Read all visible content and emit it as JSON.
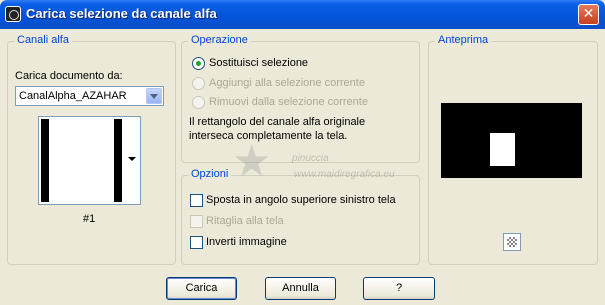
{
  "window": {
    "title": "Carica selezione da canale alfa",
    "close_glyph": "✕"
  },
  "canali_alfa": {
    "legend": "Canali alfa",
    "document_label": "Carica documento da:",
    "document_value": "CanalAlpha_AZAHAR",
    "channel_caption": "#1"
  },
  "operazione": {
    "legend": "Operazione",
    "options": [
      {
        "label": "Sostituisci selezione",
        "checked": true,
        "enabled": true
      },
      {
        "label": "Aggiungi alla selezione corrente",
        "checked": false,
        "enabled": false
      },
      {
        "label": "Rimuovi dalla selezione corrente",
        "checked": false,
        "enabled": false
      }
    ],
    "info_line1": "Il rettangolo del canale alfa originale",
    "info_line2": "interseca completamente la tela."
  },
  "opzioni": {
    "legend": "Opzioni",
    "options": [
      {
        "label": "Sposta in angolo superiore sinistro tela",
        "checked": false,
        "enabled": true
      },
      {
        "label": "Ritaglia alla tela",
        "checked": false,
        "enabled": false
      },
      {
        "label": "Inverti immagine",
        "checked": false,
        "enabled": true
      }
    ]
  },
  "anteprima": {
    "legend": "Anteprima",
    "transparency_icon": "checkerboard-icon"
  },
  "buttons": {
    "carica": "Carica",
    "annulla": "Annulla",
    "help": "?"
  },
  "watermark": {
    "name": "pinuccia",
    "url": "www.maidiregrafica.eu"
  },
  "colors": {
    "titlebar": "#0453d8",
    "legend": "#0046d5",
    "dialog_bg": "#ece9d8"
  }
}
